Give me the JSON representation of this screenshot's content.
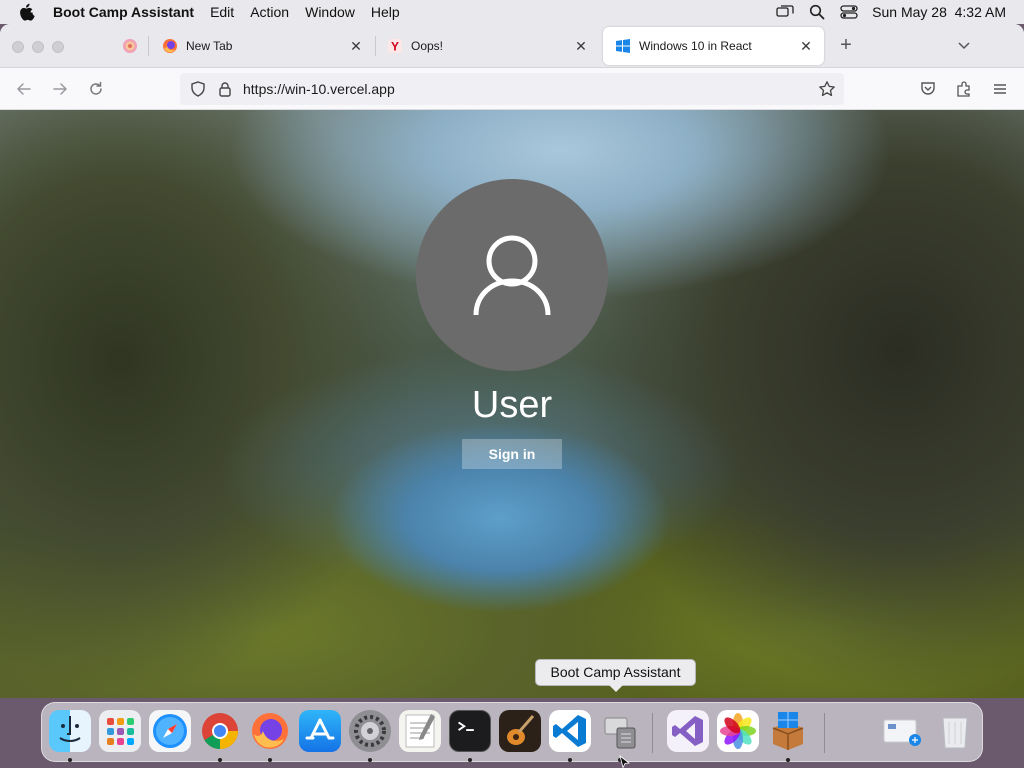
{
  "menubar": {
    "app_name": "Boot Camp Assistant",
    "items": [
      "Edit",
      "Action",
      "Window",
      "Help"
    ],
    "datetime": "Sun May 28  4:32 AM"
  },
  "tabs": [
    {
      "title": "",
      "icon": "firefox-view-icon"
    },
    {
      "title": "New Tab",
      "icon": "firefox-icon"
    },
    {
      "title": "Oops!",
      "icon": "yahoo-icon"
    },
    {
      "title": "Windows 10 in React",
      "icon": "windows-icon"
    }
  ],
  "address_bar": {
    "url": "https://win-10.vercel.app"
  },
  "login": {
    "username": "User",
    "signin_label": "Sign in"
  },
  "tooltip": "Boot Camp Assistant",
  "dock": {
    "apps": [
      "Finder",
      "Launchpad",
      "Safari",
      "Chrome",
      "Firefox",
      "App Store",
      "System Preferences",
      "TextEdit",
      "Terminal",
      "GarageBand",
      "Visual Studio Code",
      "Boot Camp Assistant",
      "Visual Studio",
      "Photos",
      "Windows Installer",
      "Downloads",
      "Trash"
    ]
  }
}
